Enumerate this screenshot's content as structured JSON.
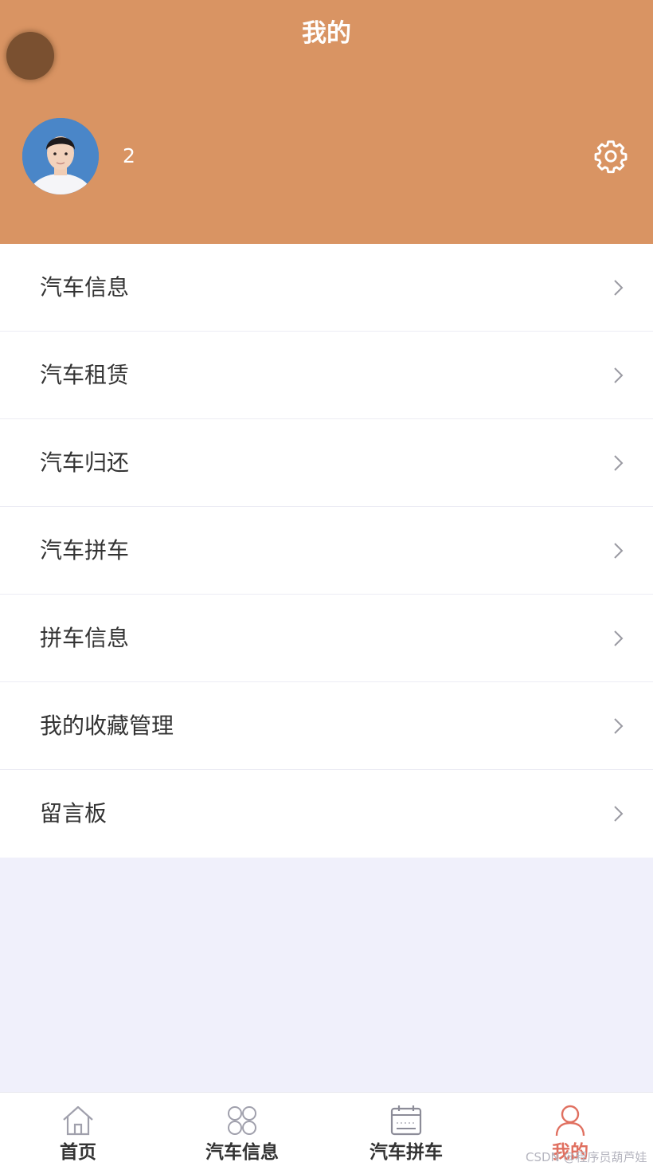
{
  "header": {
    "title": "我的",
    "username": "2",
    "background_color": "#d99463",
    "settings_icon": "gear-icon"
  },
  "menu": {
    "items": [
      {
        "label": "汽车信息"
      },
      {
        "label": "汽车租赁"
      },
      {
        "label": "汽车归还"
      },
      {
        "label": "汽车拼车"
      },
      {
        "label": "拼车信息"
      },
      {
        "label": "我的收藏管理"
      },
      {
        "label": "留言板"
      }
    ],
    "chevron_icon": "chevron-right-icon"
  },
  "tabbar": {
    "tabs": [
      {
        "label": "首页",
        "icon": "home-icon"
      },
      {
        "label": "汽车信息",
        "icon": "grid-icon"
      },
      {
        "label": "汽车拼车",
        "icon": "calendar-icon"
      },
      {
        "label": "我的",
        "icon": "user-icon",
        "active": true
      }
    ],
    "active_color": "#e07060"
  },
  "watermark": "CSDN @程序员葫芦娃"
}
